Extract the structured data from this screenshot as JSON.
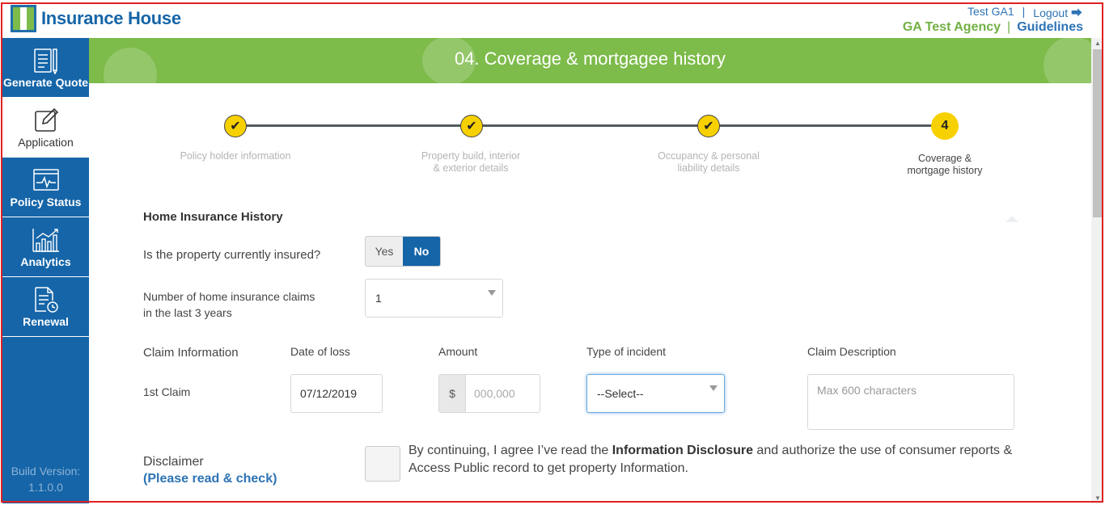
{
  "header": {
    "logo_text": "Insurance House",
    "user_name": "Test GA1",
    "separator": "|",
    "logout_label": "Logout ⮕",
    "agency_name": "GA Test Agency",
    "guidelines_label": "Guidelines"
  },
  "sidebar": {
    "items": [
      {
        "label": "Generate Quote",
        "icon": "document-list-icon"
      },
      {
        "label": "Application",
        "icon": "edit-icon"
      },
      {
        "label": "Policy Status",
        "icon": "pulse-monitor-icon"
      },
      {
        "label": "Analytics",
        "icon": "bar-chart-icon"
      },
      {
        "label": "Renewal",
        "icon": "document-clock-icon"
      }
    ],
    "build_label": "Build Version:",
    "build_version": "1.1.0.0"
  },
  "banner": {
    "title": "04. Coverage & mortgagee history"
  },
  "stepper": {
    "steps": [
      {
        "label_line1": "Policy holder information",
        "label_line2": "",
        "state": "done"
      },
      {
        "label_line1": "Property build, interior",
        "label_line2": "& exterior details",
        "state": "done"
      },
      {
        "label_line1": "Occupancy & personal",
        "label_line2": "liability details",
        "state": "done"
      },
      {
        "label_line1": "Coverage &",
        "label_line2": "mortgage history",
        "state": "current",
        "number": "4"
      }
    ],
    "check_glyph": "✔"
  },
  "form": {
    "section_title": "Home Insurance History",
    "insured_question": "Is the property currently insured?",
    "yes_label": "Yes",
    "no_label": "No",
    "claims_question_line1": "Number of home insurance claims",
    "claims_question_line2": "in the last 3 years",
    "claims_count": "1",
    "claim_info_label": "Claim Information",
    "col_date": "Date of loss",
    "col_amount": "Amount",
    "col_type": "Type of incident",
    "col_desc": "Claim Description",
    "row_label": "1st Claim",
    "date_value": "07/12/2019",
    "currency_symbol": "$",
    "amount_placeholder": "000,000",
    "type_value": "--Select--",
    "desc_placeholder": "Max 600 characters",
    "disclaimer_label": "Disclaimer",
    "please_label": "(Please read & check)",
    "disclaimer_pre": "By continuing, I agree I’ve read the ",
    "disclaimer_bold": "Information Disclosure",
    "disclaimer_post": " and authorize the use of consumer reports & Access Public record to get property Information."
  },
  "colors": {
    "brand_blue": "#1565a8",
    "brand_green": "#7dbb4a",
    "step_yellow": "#f7d000"
  }
}
